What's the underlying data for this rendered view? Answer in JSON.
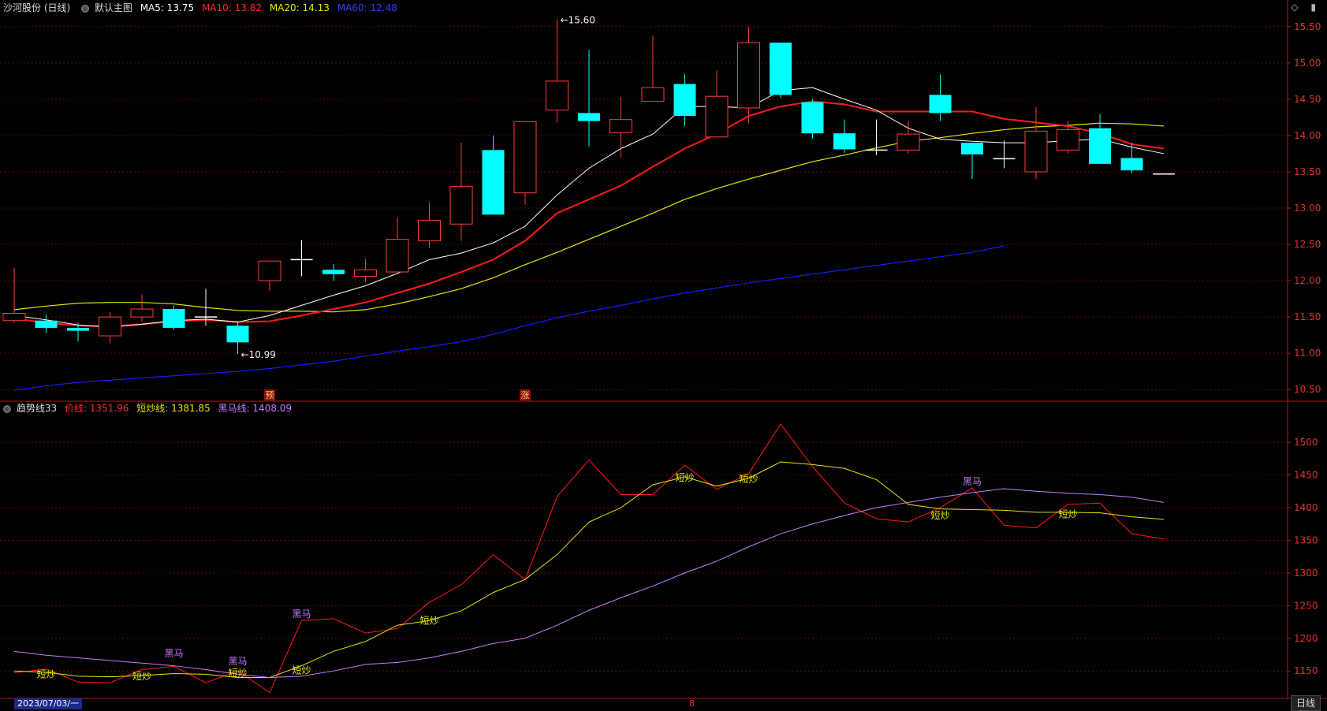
{
  "header": {
    "title": "沙河股份 (日线)",
    "main_chart_label": "默认主图",
    "ma5": "MA5: 13.75",
    "ma10": "MA10: 13.82",
    "ma20": "MA20: 14.13",
    "ma60": "MA60: 12.48",
    "window_icons": "◇ ▮"
  },
  "sub_header": {
    "name": "趋势线33",
    "price_line": "价线: 1351.96",
    "short_line": "短炒线: 1381.85",
    "black_horse_line": "黑马线: 1408.09"
  },
  "footer": {
    "date": "2023/07/03/一",
    "center_mark": "8",
    "period": "日线"
  },
  "colors": {
    "up": "#ff3b3b",
    "down": "#00ffff",
    "ma5": "#ffffff",
    "ma10": "#ff1a1a",
    "ma20": "#e6e600",
    "ma60": "#1a1aff",
    "price_line": "#ff1a1a",
    "short_line": "#e6e600",
    "black_horse_line": "#c77dff",
    "frame": "#b01818"
  },
  "chart_data": [
    {
      "type": "candlestick",
      "title": "沙河股份 (日线)",
      "y_ticks": [
        "15.50",
        "15.00",
        "14.50",
        "14.00",
        "13.50",
        "13.00",
        "12.50",
        "12.00",
        "11.50",
        "11.00",
        "10.50"
      ],
      "ylim": [
        10.35,
        15.65
      ],
      "candles": [
        {
          "o": 11.45,
          "c": 11.55,
          "h": 12.18,
          "l": 11.42
        },
        {
          "o": 11.45,
          "c": 11.35,
          "h": 11.53,
          "l": 11.28
        },
        {
          "o": 11.35,
          "c": 11.31,
          "h": 11.42,
          "l": 11.16
        },
        {
          "o": 11.24,
          "c": 11.5,
          "h": 11.57,
          "l": 11.14
        },
        {
          "o": 11.5,
          "c": 11.61,
          "h": 11.81,
          "l": 11.44
        },
        {
          "o": 11.61,
          "c": 11.35,
          "h": 11.66,
          "l": 11.32
        },
        {
          "o": 11.5,
          "c": 11.5,
          "h": 11.89,
          "l": 11.38
        },
        {
          "o": 11.38,
          "c": 11.15,
          "h": 11.43,
          "l": 10.99
        },
        {
          "o": 12.0,
          "c": 12.27,
          "h": 12.27,
          "l": 11.86
        },
        {
          "o": 12.29,
          "c": 12.29,
          "h": 12.56,
          "l": 12.06
        },
        {
          "o": 12.15,
          "c": 12.09,
          "h": 12.23,
          "l": 12.0
        },
        {
          "o": 12.06,
          "c": 12.15,
          "h": 12.3,
          "l": 11.98
        },
        {
          "o": 12.12,
          "c": 12.57,
          "h": 12.87,
          "l": 12.12
        },
        {
          "o": 12.55,
          "c": 12.83,
          "h": 13.08,
          "l": 12.45
        },
        {
          "o": 12.78,
          "c": 13.3,
          "h": 13.9,
          "l": 12.55
        },
        {
          "o": 13.8,
          "c": 12.91,
          "h": 14.0,
          "l": 12.91
        },
        {
          "o": 13.21,
          "c": 14.19,
          "h": 14.19,
          "l": 13.05
        },
        {
          "o": 14.35,
          "c": 14.75,
          "h": 15.6,
          "l": 14.18
        },
        {
          "o": 14.31,
          "c": 14.2,
          "h": 15.18,
          "l": 13.85
        },
        {
          "o": 14.04,
          "c": 14.22,
          "h": 14.53,
          "l": 13.7
        },
        {
          "o": 14.47,
          "c": 14.66,
          "h": 15.38,
          "l": 14.47
        },
        {
          "o": 14.71,
          "c": 14.27,
          "h": 14.85,
          "l": 14.13
        },
        {
          "o": 13.98,
          "c": 14.54,
          "h": 14.9,
          "l": 13.98
        },
        {
          "o": 14.38,
          "c": 15.28,
          "h": 15.5,
          "l": 14.17
        },
        {
          "o": 15.28,
          "c": 14.56,
          "h": 15.28,
          "l": 14.52
        },
        {
          "o": 14.46,
          "c": 14.03,
          "h": 14.5,
          "l": 13.96
        },
        {
          "o": 14.03,
          "c": 13.81,
          "h": 14.22,
          "l": 13.76
        },
        {
          "o": 13.8,
          "c": 13.8,
          "h": 14.22,
          "l": 13.73
        },
        {
          "o": 13.8,
          "c": 14.02,
          "h": 14.2,
          "l": 13.75
        },
        {
          "o": 14.56,
          "c": 14.31,
          "h": 14.84,
          "l": 14.2
        },
        {
          "o": 13.9,
          "c": 13.74,
          "h": 13.9,
          "l": 13.4
        },
        {
          "o": 13.68,
          "c": 13.68,
          "h": 13.93,
          "l": 13.55
        },
        {
          "o": 13.5,
          "c": 14.06,
          "h": 14.39,
          "l": 13.4
        },
        {
          "o": 13.8,
          "c": 14.08,
          "h": 14.2,
          "l": 13.75
        },
        {
          "o": 14.1,
          "c": 13.61,
          "h": 14.3,
          "l": 13.61
        },
        {
          "o": 13.69,
          "c": 13.52,
          "h": 13.9,
          "l": 13.48
        },
        {
          "o": 13.47,
          "c": 13.47,
          "h": 13.47,
          "l": 13.47
        }
      ],
      "ma5": [
        11.52,
        11.46,
        11.39,
        11.36,
        11.4,
        11.45,
        11.47,
        11.43,
        11.52,
        11.66,
        11.8,
        11.93,
        12.1,
        12.29,
        12.38,
        12.52,
        12.75,
        13.18,
        13.55,
        13.82,
        14.02,
        14.4,
        14.4,
        14.38,
        14.62,
        14.66,
        14.5,
        14.35,
        14.1,
        13.95,
        13.92,
        13.9,
        13.9,
        13.93,
        13.95,
        13.84,
        13.75
      ],
      "ma10": [
        11.48,
        11.42,
        11.38,
        11.37,
        11.4,
        11.44,
        11.46,
        11.43,
        11.44,
        11.52,
        11.61,
        11.7,
        11.83,
        11.96,
        12.12,
        12.29,
        12.55,
        12.93,
        13.12,
        13.31,
        13.57,
        13.82,
        14.02,
        14.27,
        14.4,
        14.47,
        14.43,
        14.33,
        14.33,
        14.33,
        14.33,
        14.23,
        14.18,
        14.13,
        14.03,
        13.88,
        13.82
      ],
      "ma20": [
        11.6,
        11.65,
        11.69,
        11.7,
        11.7,
        11.68,
        11.63,
        11.59,
        11.58,
        11.58,
        11.57,
        11.6,
        11.68,
        11.78,
        11.89,
        12.04,
        12.22,
        12.39,
        12.57,
        12.75,
        12.93,
        13.12,
        13.27,
        13.4,
        13.52,
        13.64,
        13.73,
        13.83,
        13.92,
        13.97,
        14.03,
        14.08,
        14.12,
        14.14,
        14.17,
        14.16,
        14.13
      ],
      "ma60": [
        10.49,
        10.55,
        10.6,
        10.63,
        10.66,
        10.69,
        10.72,
        10.75,
        10.79,
        10.84,
        10.89,
        10.96,
        11.03,
        11.09,
        11.16,
        11.26,
        11.38,
        11.49,
        11.58,
        11.66,
        11.75,
        11.83,
        11.9,
        11.97,
        12.03,
        12.09,
        12.15,
        12.21,
        12.27,
        12.33,
        12.39,
        12.48
      ],
      "annotations": [
        {
          "text": "15.60",
          "index": 17,
          "value": 15.6
        },
        {
          "text": "10.99",
          "index": 7,
          "value": 10.99
        }
      ],
      "bottom_markers": [
        {
          "text": "预",
          "index": 8
        },
        {
          "text": "涨",
          "index": 16
        }
      ]
    },
    {
      "type": "line",
      "title": "趋势线33",
      "y_ticks": [
        "1500",
        "1450",
        "1400",
        "1350",
        "1300",
        "1250",
        "1200",
        "1150"
      ],
      "ylim": [
        1108,
        1540
      ],
      "series": [
        {
          "name": "价线",
          "values": [
            1147,
            1153,
            1133,
            1132,
            1152,
            1157,
            1132,
            1150,
            1117,
            1227,
            1230,
            1208,
            1215,
            1255,
            1282,
            1328,
            1290,
            1417,
            1473,
            1420,
            1420,
            1465,
            1428,
            1452,
            1528,
            1463,
            1407,
            1383,
            1378,
            1400,
            1430,
            1373,
            1369,
            1405,
            1407,
            1360,
            1352
          ]
        },
        {
          "name": "短炒线",
          "values": [
            1150,
            1148,
            1142,
            1141,
            1143,
            1146,
            1145,
            1140,
            1140,
            1158,
            1180,
            1195,
            1220,
            1227,
            1242,
            1270,
            1290,
            1328,
            1378,
            1400,
            1435,
            1447,
            1433,
            1445,
            1470,
            1466,
            1460,
            1443,
            1405,
            1398,
            1397,
            1396,
            1393,
            1393,
            1392,
            1386,
            1382
          ]
        },
        {
          "name": "黑马线",
          "values": [
            1180,
            1174,
            1170,
            1166,
            1162,
            1158,
            1152,
            1145,
            1140,
            1142,
            1150,
            1160,
            1163,
            1170,
            1180,
            1192,
            1200,
            1220,
            1243,
            1262,
            1280,
            1300,
            1318,
            1340,
            1360,
            1375,
            1388,
            1400,
            1408,
            1416,
            1423,
            1429,
            1425,
            1422,
            1420,
            1416,
            1408
          ]
        }
      ],
      "annotations": [
        {
          "text": "短炒",
          "index": 1,
          "value": 1140
        },
        {
          "text": "短炒",
          "index": 4,
          "value": 1137
        },
        {
          "text": "黑马",
          "index": 5,
          "value": 1172
        },
        {
          "text": "黑马",
          "index": 7,
          "value": 1160
        },
        {
          "text": "短炒",
          "index": 7,
          "value": 1142
        },
        {
          "text": "短炒",
          "index": 9,
          "value": 1146
        },
        {
          "text": "黑马",
          "index": 9,
          "value": 1232
        },
        {
          "text": "短炒",
          "index": 13,
          "value": 1222
        },
        {
          "text": "短炒",
          "index": 21,
          "value": 1441
        },
        {
          "text": "短炒",
          "index": 23,
          "value": 1439
        },
        {
          "text": "短炒",
          "index": 29,
          "value": 1383
        },
        {
          "text": "黑马",
          "index": 30,
          "value": 1435
        },
        {
          "text": "短炒",
          "index": 33,
          "value": 1385
        }
      ]
    }
  ]
}
